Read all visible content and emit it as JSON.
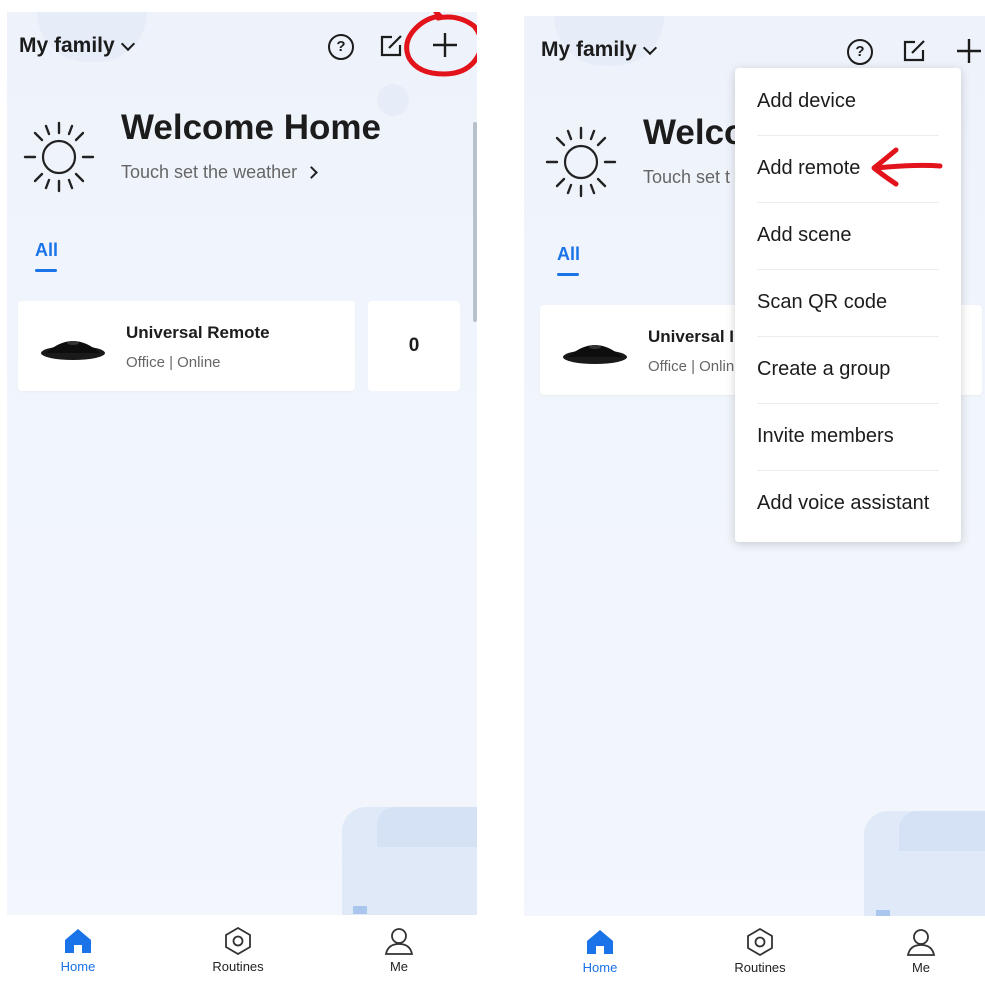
{
  "screens": [
    {
      "header": {
        "family": "My family"
      },
      "welcome": {
        "title": "Welcome Home",
        "weather_link": "Touch set the weather"
      },
      "tabs": [
        {
          "label": "All"
        }
      ],
      "device": {
        "name": "Universal Remote",
        "status": "Office | Online"
      },
      "count_card": {
        "value": "0"
      },
      "tabbar": [
        {
          "label": "Home",
          "icon": "home-icon"
        },
        {
          "label": "Routines",
          "icon": "hexagon-icon"
        },
        {
          "label": "Me",
          "icon": "person-icon"
        }
      ]
    },
    {
      "header": {
        "family": "My family"
      },
      "welcome": {
        "title": "Welco",
        "weather_link": "Touch set t"
      },
      "tabs": [
        {
          "label": "All"
        }
      ],
      "device": {
        "name": "Universal I",
        "status": "Office | Onlin"
      },
      "menu": [
        {
          "label": "Add device"
        },
        {
          "label": "Add remote"
        },
        {
          "label": "Add scene"
        },
        {
          "label": "Scan QR code"
        },
        {
          "label": "Create a group"
        },
        {
          "label": "Invite members"
        },
        {
          "label": "Add voice assistant"
        }
      ],
      "tabbar": [
        {
          "label": "Home",
          "icon": "home-icon"
        },
        {
          "label": "Routines",
          "icon": "hexagon-icon"
        },
        {
          "label": "Me",
          "icon": "person-icon"
        }
      ]
    }
  ],
  "colors": {
    "accent": "#1a73e8",
    "annotation": "#e3131b",
    "background": "#eef3fb"
  }
}
